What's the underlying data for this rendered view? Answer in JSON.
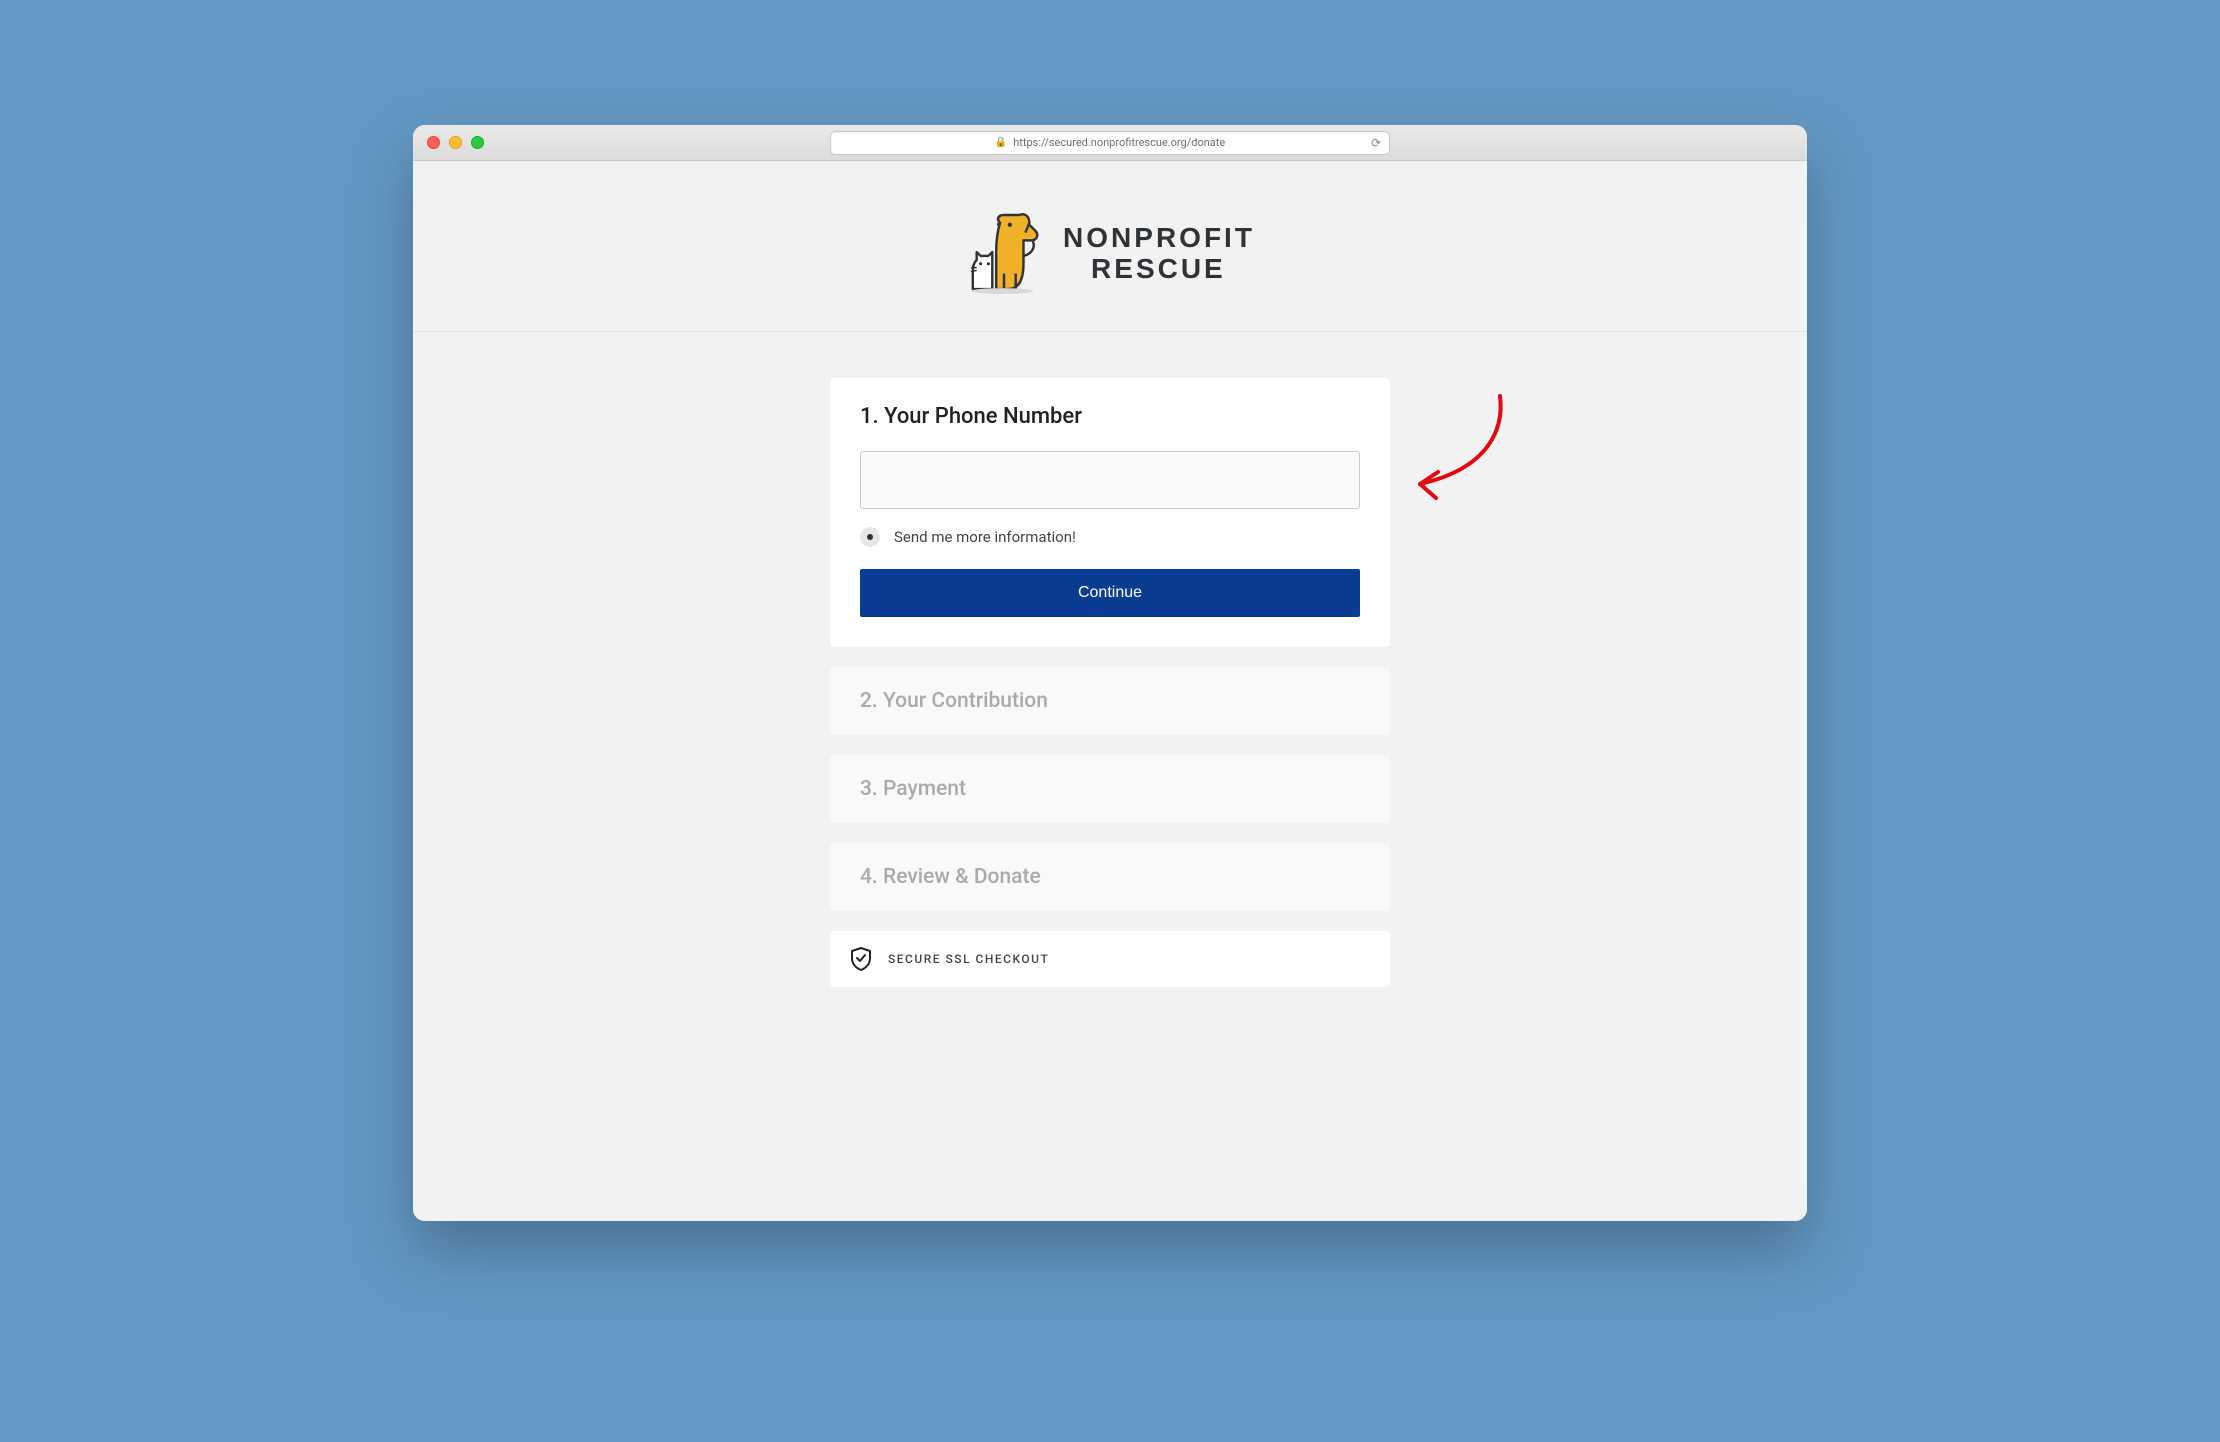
{
  "browser": {
    "url_display": "https://secured.nonprofitrescue.org/donate"
  },
  "brand": {
    "line1": "NONPROFIT",
    "line2": "RESCUE"
  },
  "step1": {
    "title": "1.  Your Phone Number",
    "phone_value": "",
    "opt_in_label": "Send me more information!",
    "continue_label": "Continue"
  },
  "step2": {
    "title": "2.  Your Contribution"
  },
  "step3": {
    "title": "3.  Payment"
  },
  "step4": {
    "title": "4.  Review & Donate"
  },
  "ssl": {
    "label": "SECURE SSL CHECKOUT"
  }
}
